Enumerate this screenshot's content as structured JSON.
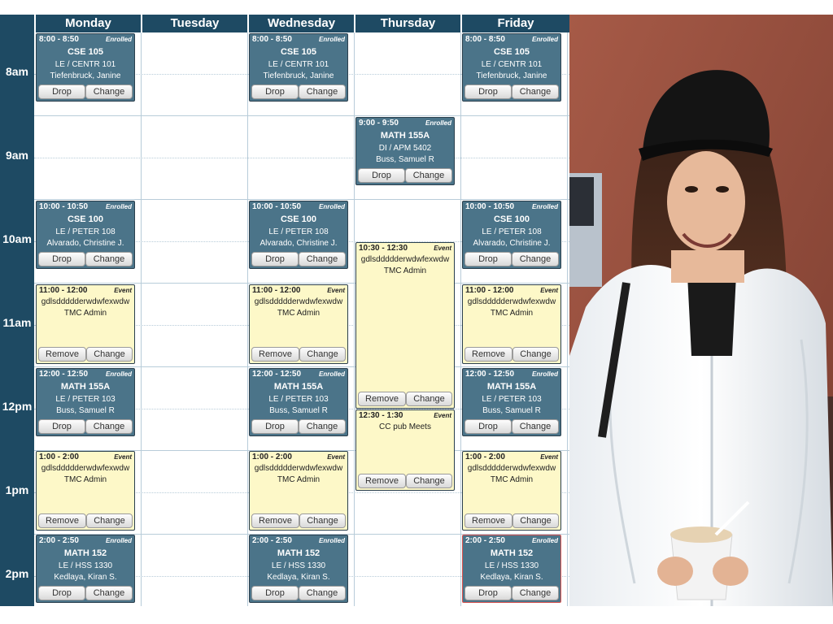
{
  "days": [
    "Monday",
    "Tuesday",
    "Wednesday",
    "Thursday",
    "Friday"
  ],
  "times": [
    "8am",
    "9am",
    "10am",
    "11am",
    "12pm",
    "1pm",
    "2pm"
  ],
  "status": {
    "enrolled": "Enrolled",
    "event": "Event"
  },
  "buttons": {
    "drop": "Drop",
    "change": "Change",
    "remove": "Remove"
  },
  "courses": [
    {
      "time": "8:00 - 8:50",
      "code": "CSE 105",
      "section": "LE / CENTR 101",
      "instructor": "Tiefenbruck, Janine"
    },
    {
      "time": "9:00 - 9:50",
      "code": "MATH 155A",
      "section": "DI / APM 5402",
      "instructor": "Buss, Samuel R"
    },
    {
      "time": "10:00 - 10:50",
      "code": "CSE 100",
      "section": "LE / PETER 108",
      "instructor": "Alvarado, Christine J."
    },
    {
      "time": "12:00 - 12:50",
      "code": "MATH 155A",
      "section": "LE / PETER 103",
      "instructor": "Buss, Samuel R"
    },
    {
      "time": "2:00 - 2:50",
      "code": "MATH 152",
      "section": "LE / HSS 1330",
      "instructor": "Kedlaya, Kiran S."
    }
  ],
  "personal_events": [
    {
      "time": "11:00 - 12:00",
      "title": "gdlsddddderwdwfexwdw",
      "organizer": "TMC Admin"
    },
    {
      "time": "1:00 - 2:00",
      "title": "gdlsddddderwdwfexwdw",
      "organizer": "TMC Admin"
    },
    {
      "time": "10:30 - 12:30",
      "title": "gdlsddddderwdwfexwdw",
      "organizer": "TMC Admin"
    },
    {
      "time": "12:30 - 1:30",
      "title": "CC pub Meets",
      "organizer": ""
    }
  ],
  "colors": {
    "header": "#1e4a63",
    "course_block": "#4b7489",
    "event_block": "#fdf8c8"
  }
}
